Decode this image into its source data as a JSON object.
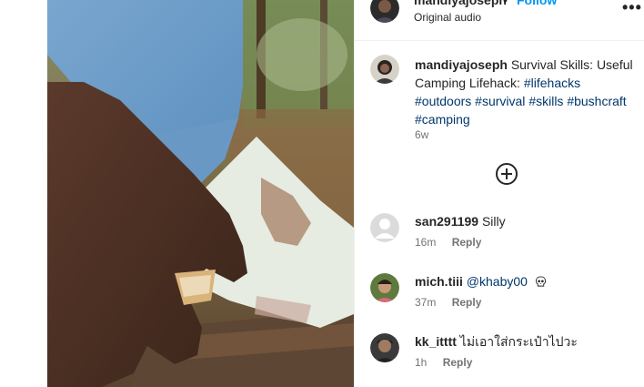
{
  "header": {
    "username": "mandiyajoseph",
    "separator": "•",
    "follow_label": "Follow",
    "audio_label": "Original audio",
    "more_label": "•••"
  },
  "caption": {
    "username": "mandiyajoseph",
    "text": "Survival Skills: Useful Camping Lifehack:",
    "hashtags": [
      "#lifehacks",
      "#outdoors",
      "#survival",
      "#skills",
      "#bushcraft",
      "#camping"
    ],
    "time": "6w"
  },
  "load_more": {
    "icon": "plus-circle-icon"
  },
  "comments": [
    {
      "username": "san291199",
      "text": "Silly",
      "mention": "",
      "time": "16m",
      "reply_label": "Reply"
    },
    {
      "username": "mich.tiii",
      "text": "",
      "mention": "@khaby00",
      "time": "37m",
      "reply_label": "Reply"
    },
    {
      "username": "kk_itttt",
      "text": "ไม่เอาใส่กระเป๋าไปวะ",
      "mention": "",
      "time": "1h",
      "reply_label": "Reply"
    }
  ],
  "colors": {
    "link": "#00376b",
    "follow": "#0095f6",
    "muted": "#737373",
    "text": "#262626"
  }
}
